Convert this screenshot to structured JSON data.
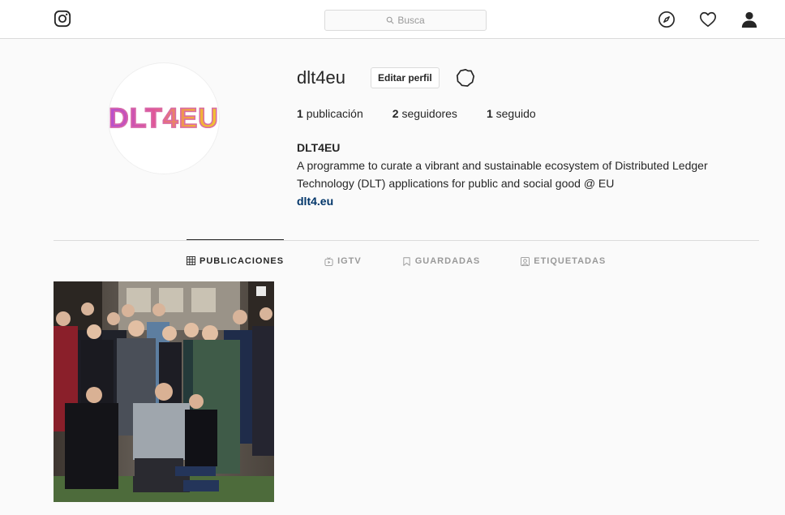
{
  "search": {
    "placeholder": "Busca"
  },
  "profile": {
    "username": "dlt4eu",
    "edit_label": "Editar perfil",
    "avatar_text": "DLT4EU",
    "stats": [
      {
        "count": "1",
        "label": "publicación"
      },
      {
        "count": "2",
        "label": "seguidores"
      },
      {
        "count": "1",
        "label": "seguido"
      }
    ],
    "bio_name": "DLT4EU",
    "bio_text": "A programme to curate a vibrant and sustainable ecosystem of Distributed Ledger Technology (DLT) applications for public and social good @ EU",
    "bio_link": "dlt4.eu"
  },
  "tabs": [
    {
      "label": "PUBLICACIONES",
      "icon": "grid-icon"
    },
    {
      "label": "IGTV",
      "icon": "tv-icon"
    },
    {
      "label": "GUARDADAS",
      "icon": "bookmark-icon"
    },
    {
      "label": "ETIQUETADAS",
      "icon": "tag-icon"
    }
  ],
  "colors": {
    "link": "#003569",
    "border": "#dbdbdb",
    "muted": "#999999"
  }
}
